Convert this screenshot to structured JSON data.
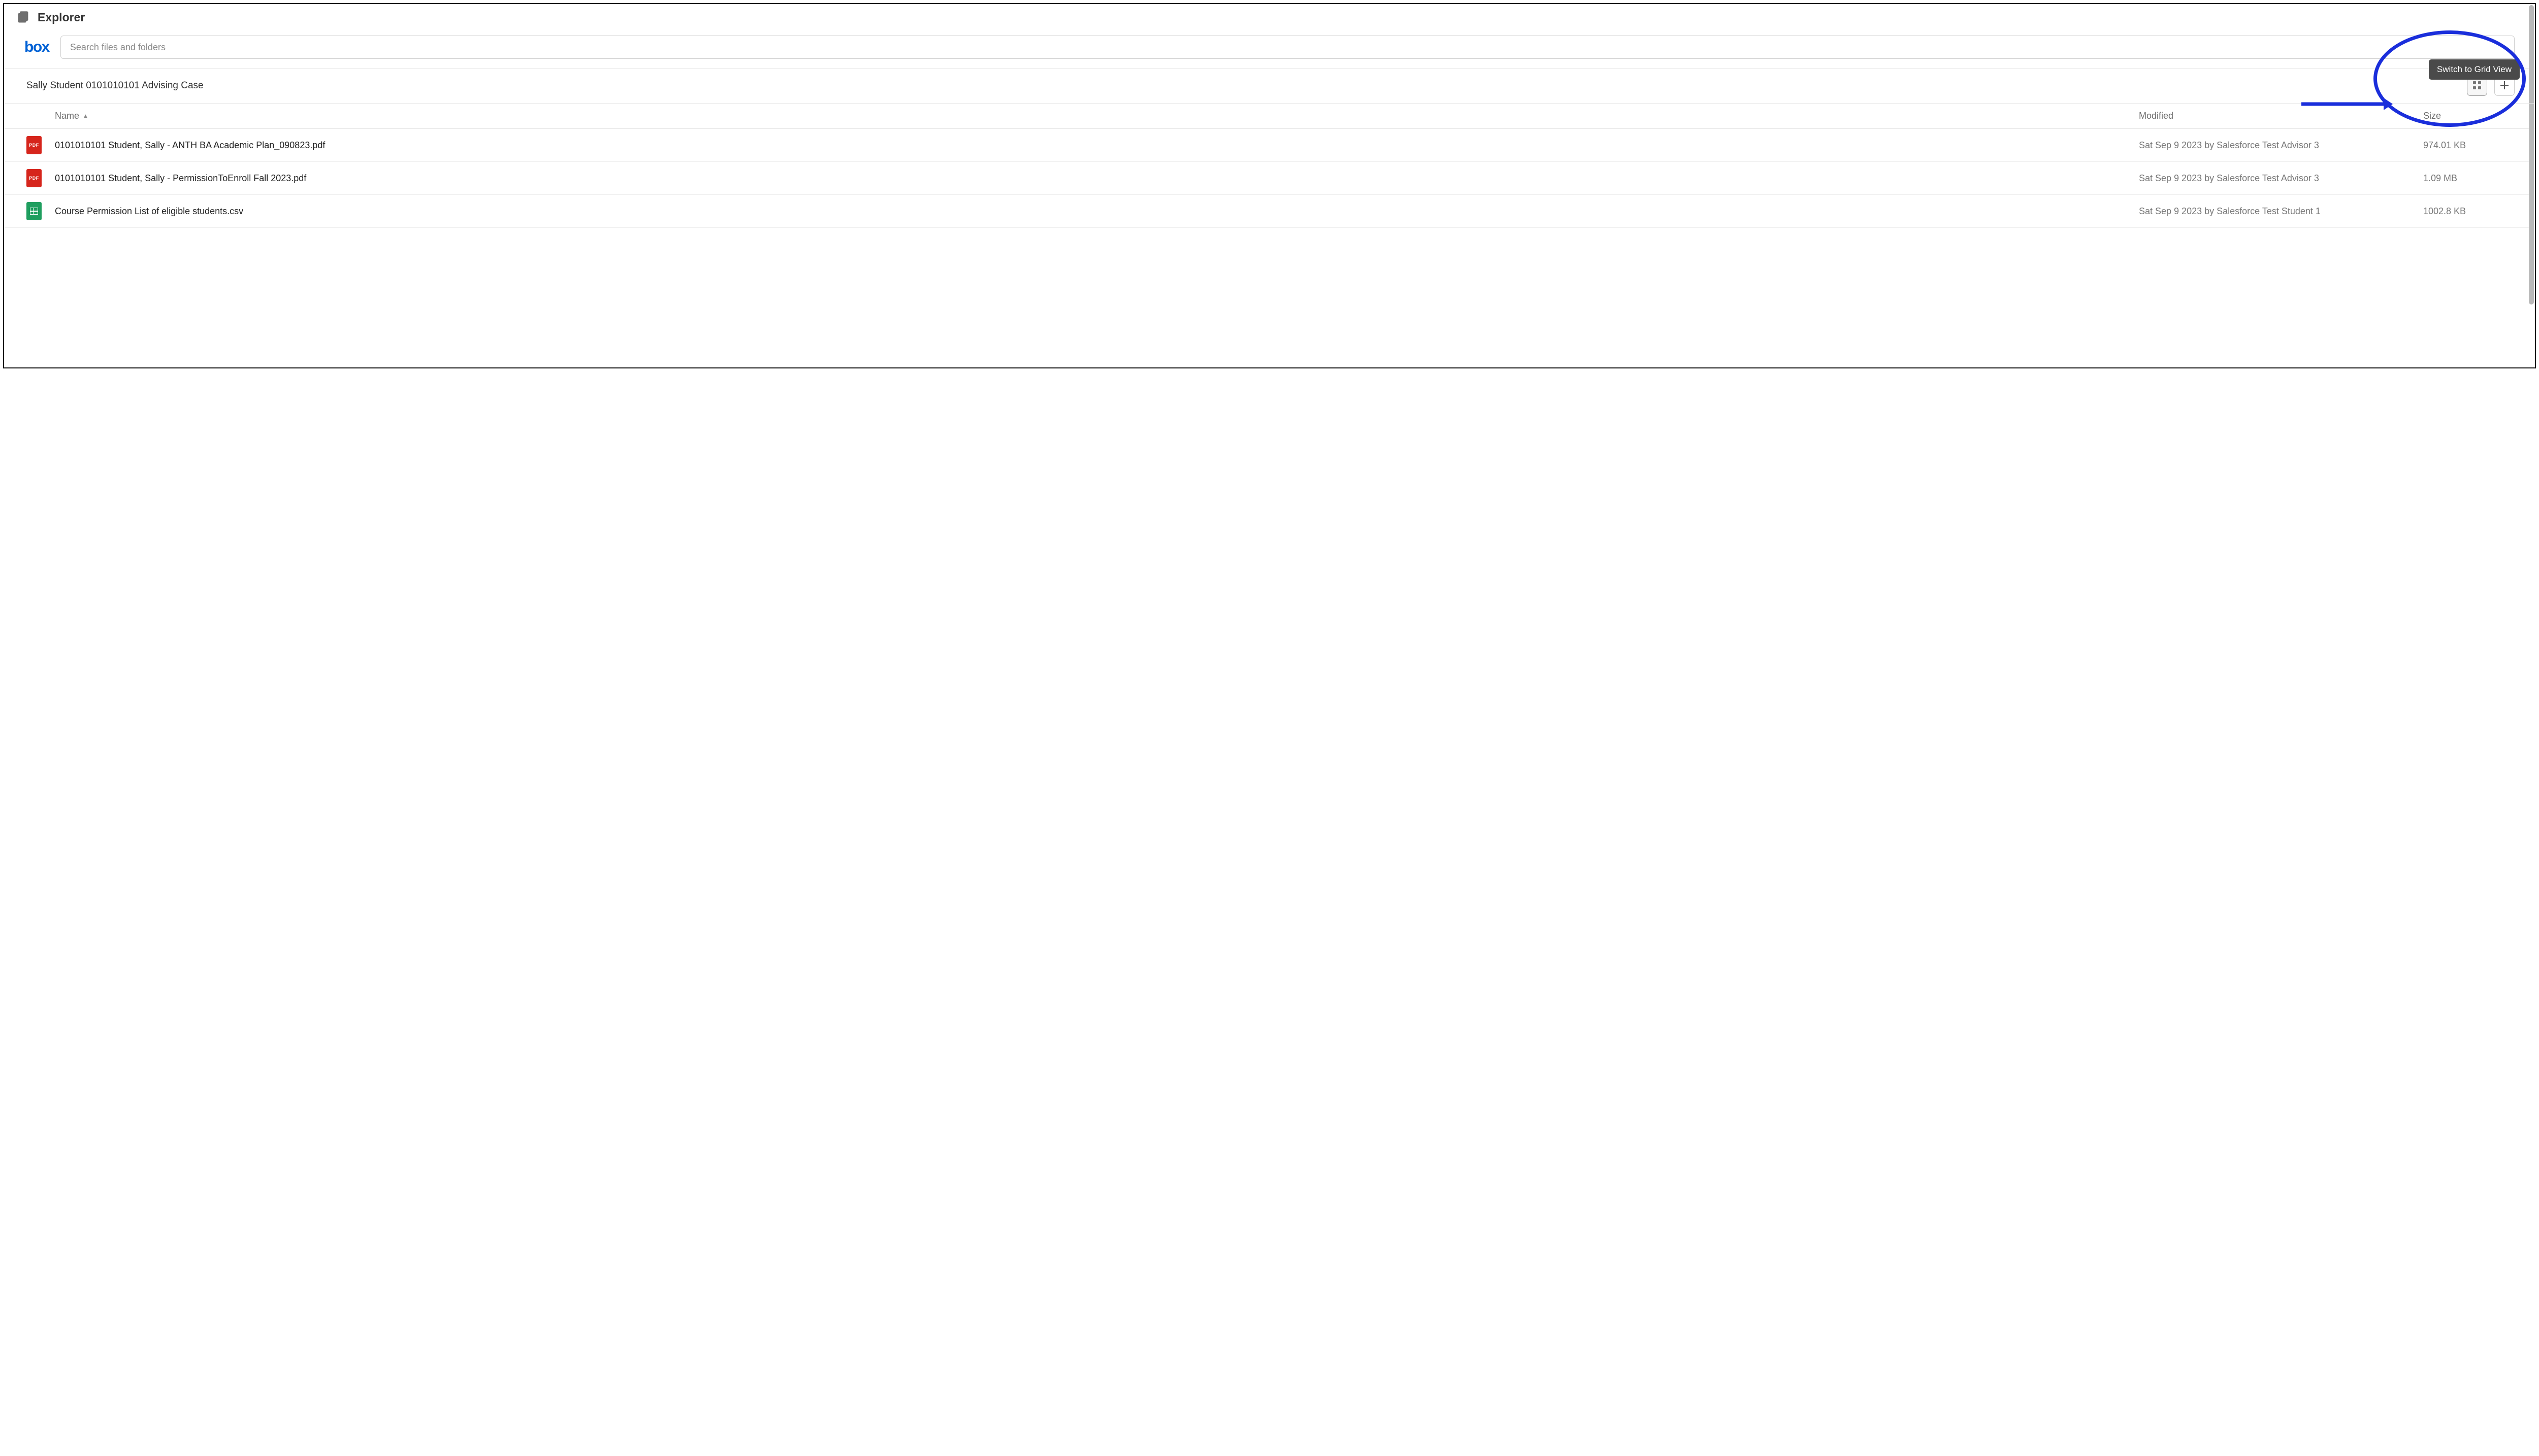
{
  "header": {
    "title": "Explorer"
  },
  "search": {
    "placeholder": "Search files and folders",
    "value": ""
  },
  "logo_text": "box",
  "breadcrumb": "Sally Student 0101010101 Advising Case",
  "tooltip": "Switch to Grid View",
  "columns": {
    "name": "Name",
    "modified": "Modified",
    "size": "Size",
    "sort_indicator": "▲"
  },
  "files": [
    {
      "type": "pdf",
      "name": "0101010101 Student, Sally - ANTH BA Academic Plan_090823.pdf",
      "modified": "Sat Sep 9 2023 by Salesforce Test Advisor 3",
      "size": "974.01 KB"
    },
    {
      "type": "pdf",
      "name": "0101010101 Student, Sally - PermissionToEnroll Fall 2023.pdf",
      "modified": "Sat Sep 9 2023 by Salesforce Test Advisor 3",
      "size": "1.09 MB"
    },
    {
      "type": "csv",
      "name": "Course Permission List of eligible students.csv",
      "modified": "Sat Sep 9 2023 by Salesforce Test Student 1",
      "size": "1002.8 KB"
    }
  ],
  "icon_labels": {
    "pdf": "PDF"
  }
}
